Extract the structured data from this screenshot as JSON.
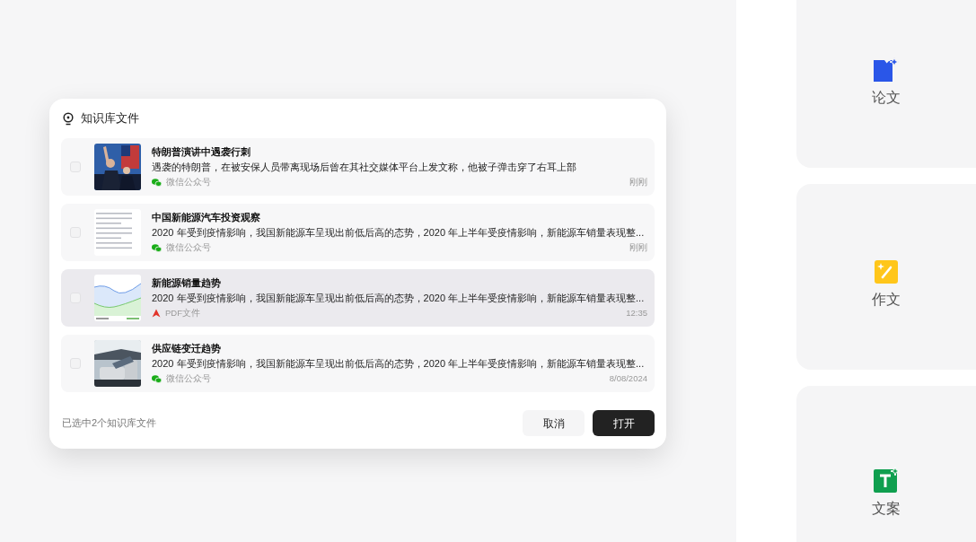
{
  "dialog": {
    "title": "知识库文件",
    "items": [
      {
        "title": "特朗普演讲中遇袭行刺",
        "summary": "遇袭的特朗普，在被安保人员带离现场后曾在其社交媒体平台上发文称，他被子弹击穿了右耳上部",
        "source": {
          "text": "微信公众号",
          "kind": "wechat"
        },
        "time": "刚刚",
        "checked": false,
        "highlighted": false
      },
      {
        "title": "中国新能源汽车投资观察",
        "summary": "2020 年受到疫情影响，我国新能源车呈现出前低后高的态势，2020 年上半年受疫情影响，新能源车销量表现整...",
        "source": {
          "text": "微信公众号",
          "kind": "wechat"
        },
        "time": "刚刚",
        "thumbnail": {
          "kind": "document"
        },
        "checked": false,
        "highlighted": false
      },
      {
        "title": "新能源销量趋势",
        "summary": "2020 年受到疫情影响，我国新能源车呈现出前低后高的态势，2020 年上半年受疫情影响，新能源车销量表现整...",
        "source": {
          "text": "PDF文件",
          "kind": "pdf"
        },
        "time": "12:35",
        "thumbnail": {
          "kind": "chart"
        },
        "checked": false,
        "highlighted": true
      },
      {
        "title": "供应链变迁趋势",
        "summary": "2020 年受到疫情影响，我国新能源车呈现出前低后高的态势，2020 年上半年受疫情影响，新能源车销量表现整...",
        "source": {
          "text": "微信公众号",
          "kind": "wechat"
        },
        "time": "8/08/2024",
        "thumbnail": {
          "kind": "car"
        },
        "checked": false,
        "highlighted": false
      }
    ],
    "selection_count": "已选中2个知识库文件",
    "buttons": [
      {
        "label": "取消",
        "kind": "secondary"
      },
      {
        "label": "打开",
        "kind": "primary"
      }
    ]
  },
  "side_cards": [
    {
      "label": "论文",
      "kind": "paper"
    },
    {
      "label": "作文",
      "kind": "essay"
    },
    {
      "label": "文案",
      "kind": "copy"
    }
  ]
}
